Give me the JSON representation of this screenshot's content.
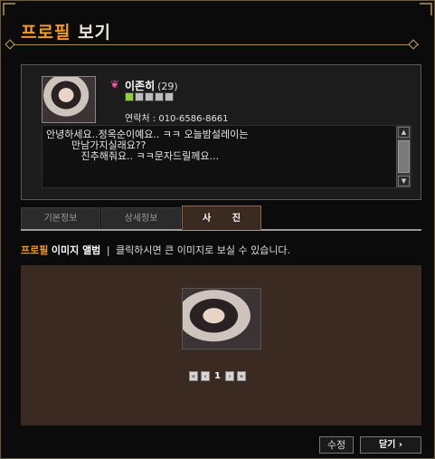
{
  "window": {
    "title_accent": "프로필",
    "title_rest": "보기"
  },
  "profile": {
    "name": "이존히",
    "age": "(29)",
    "grade": {
      "filled": 1,
      "total": 5
    },
    "contact": "연락처 : 010-6586-8661",
    "message_lines": [
      "안녕하세요..정옥순이예요.. ㅋㅋ 오늘밤설레이는",
      "        만남가지실래요??",
      "           진추해줘요.. ㅋㅋ문자드릴께요..."
    ]
  },
  "tabs": [
    {
      "label": "기본정보",
      "active": false
    },
    {
      "label": "상세정보",
      "active": false
    },
    {
      "label": "사 진",
      "active": true
    }
  ],
  "album": {
    "heading_accent": "프로필",
    "heading_bold": "이미지 앨범",
    "separator": "|",
    "hint": "클릭하시면 큰 이미지로 보실 수 있습니다.",
    "pager": {
      "first": "«",
      "prev": "‹",
      "current_page": "1",
      "next": "›",
      "last": "»"
    }
  },
  "buttons": {
    "edit": "수정",
    "close": "닫기 ›"
  },
  "colors": {
    "accent": "#f19a29",
    "album_bg": "#3a2a22",
    "grade_on": "#8fd23a"
  }
}
